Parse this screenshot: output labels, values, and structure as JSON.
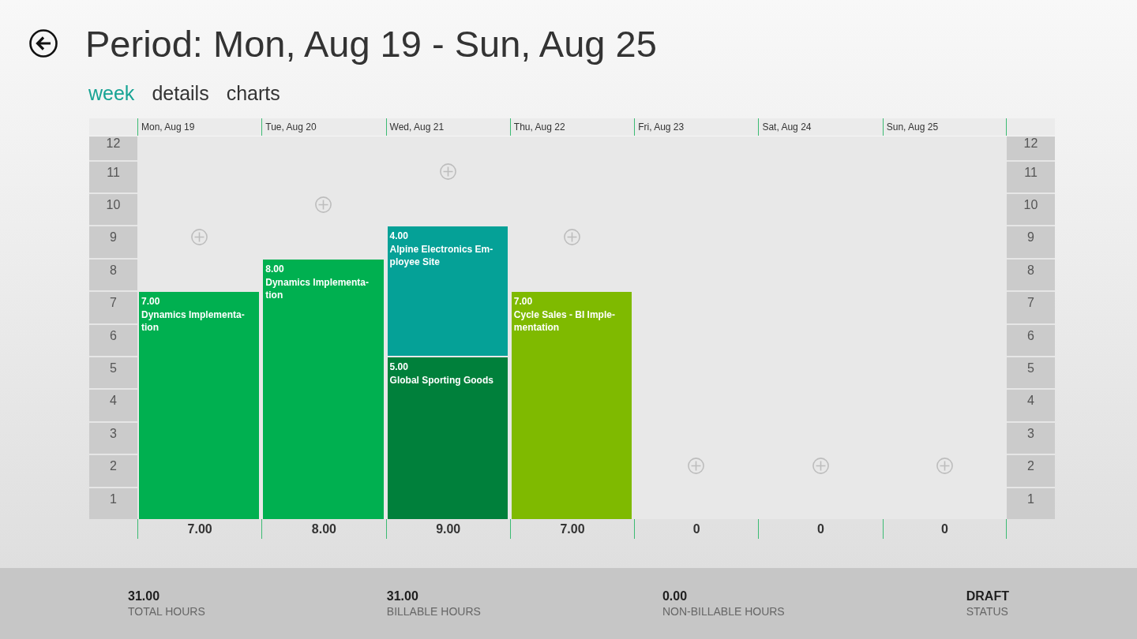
{
  "header": {
    "title": "Period: Mon, Aug 19 - Sun, Aug 25"
  },
  "tabs": [
    {
      "label": "week",
      "selected": true
    },
    {
      "label": "details",
      "selected": false
    },
    {
      "label": "charts",
      "selected": false
    }
  ],
  "week_grid": {
    "left_axis": [
      "12",
      "11",
      "10",
      "9",
      "8",
      "7",
      "6",
      "5",
      "4",
      "3",
      "2",
      "1"
    ],
    "days": [
      {
        "label": "Mon, Aug 19",
        "entries": [
          {
            "hours": "7.00",
            "project": "Dynamics Implementa-tion",
            "color": "#00b050"
          }
        ],
        "total": "7.00"
      },
      {
        "label": "Tue, Aug 20",
        "entries": [
          {
            "hours": "8.00",
            "project": "Dynamics Implementa-tion",
            "color": "#00b050"
          }
        ],
        "total": "8.00"
      },
      {
        "label": "Wed, Aug 21",
        "entries": [
          {
            "hours": "4.00",
            "project": "Alpine Electronics Em-ployee Site",
            "color": "#05a197"
          },
          {
            "hours": "5.00",
            "project": "Global Sporting Goods",
            "color": "#00803b"
          }
        ],
        "total": "9.00"
      },
      {
        "label": "Thu, Aug 22",
        "entries": [
          {
            "hours": "7.00",
            "project": "Cycle Sales - BI Imple-mentation",
            "color": "#7fba00"
          }
        ],
        "total": "7.00"
      },
      {
        "label": "Fri, Aug 23",
        "total": "0"
      },
      {
        "label": "Sat, Aug 24",
        "total": "0"
      },
      {
        "label": "Sun, Aug 25",
        "total": "0"
      }
    ],
    "right_axis": [
      "12",
      "11",
      "10",
      "9",
      "8",
      "7",
      "6",
      "5",
      "4",
      "3",
      "2",
      "1"
    ]
  },
  "summary": [
    {
      "value": "31.00",
      "label": "TOTAL HOURS"
    },
    {
      "value": "31.00",
      "label": "BILLABLE HOURS"
    },
    {
      "value": "0.00",
      "label": "NON-BILLABLE HOURS"
    },
    {
      "value": "DRAFT",
      "label": "STATUS"
    }
  ]
}
